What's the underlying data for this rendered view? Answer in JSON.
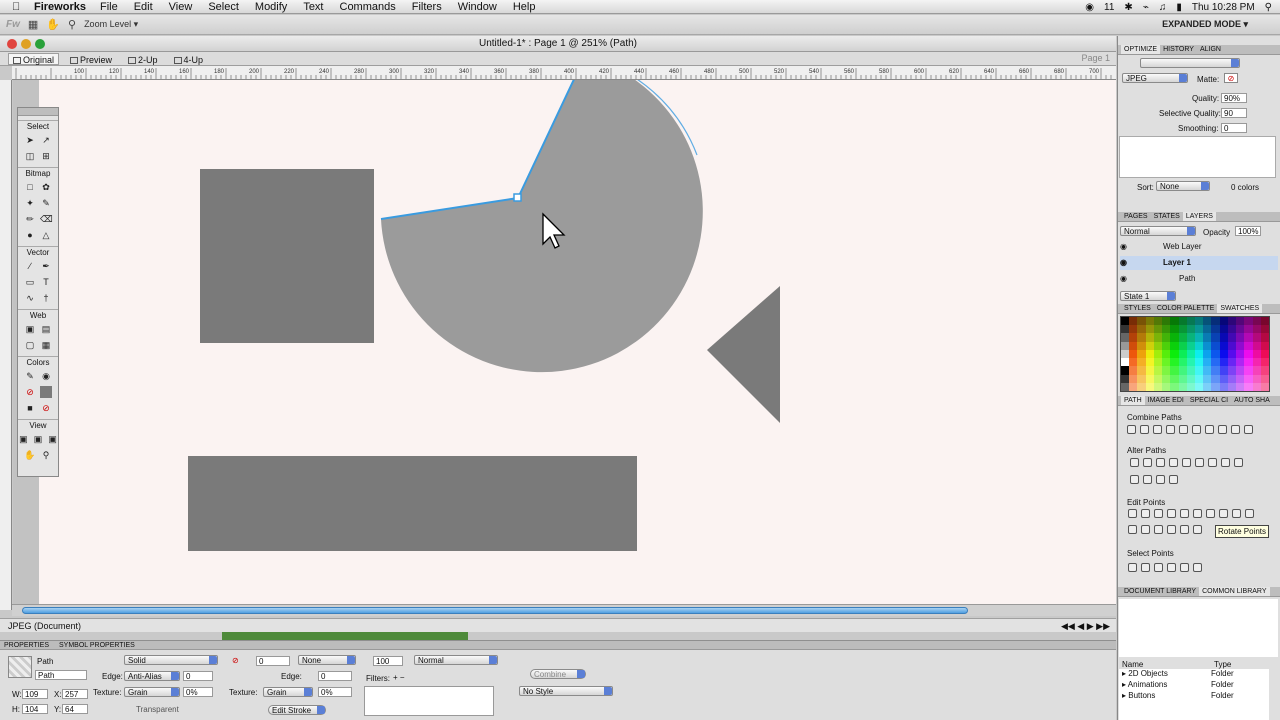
{
  "menubar": {
    "app_name": "Fireworks",
    "items": [
      "File",
      "Edit",
      "View",
      "Select",
      "Modify",
      "Text",
      "Commands",
      "Filters",
      "Window",
      "Help"
    ],
    "status_num": "11",
    "clock": "Thu 10:28 PM"
  },
  "toolbar": {
    "zoom_label": "Zoom Level",
    "expanded_mode": "EXPANDED MODE"
  },
  "document": {
    "title": "Untitled-1* : Page 1 @ 251% (Path)",
    "view_tabs": [
      "Original",
      "Preview",
      "2-Up",
      "4-Up"
    ],
    "page_label": "Page 1",
    "ruler_ticks": [
      "100",
      "120",
      "140",
      "160",
      "180",
      "200",
      "220",
      "240",
      "280",
      "300",
      "320",
      "340",
      "360",
      "380",
      "400",
      "420",
      "440",
      "460",
      "480",
      "500",
      "520",
      "540",
      "560",
      "580",
      "600",
      "620",
      "640",
      "660",
      "680",
      "700"
    ],
    "status": "JPEG (Document)"
  },
  "tools": {
    "sections": [
      "Select",
      "Bitmap",
      "Vector",
      "Web",
      "Colors",
      "View"
    ]
  },
  "properties": {
    "tabs": [
      "PROPERTIES",
      "SYMBOL PROPERTIES"
    ],
    "object_type": "Path",
    "object_name": "Path",
    "fill_type": "Solid",
    "edge_label": "Edge:",
    "edge_value": "Anti-Alias",
    "edge_num": "0",
    "texture_label": "Texture:",
    "texture_value": "Grain",
    "texture_pct": "0%",
    "transparent_label": "Transparent",
    "stroke_size": "0",
    "stroke_type": "None",
    "stroke_edge_label": "Edge:",
    "stroke_edge_num": "0",
    "stroke_texture_label": "Texture:",
    "stroke_texture_value": "Grain",
    "stroke_texture_pct": "0%",
    "edit_stroke": "Edit Stroke",
    "opacity": "100",
    "blend": "Normal",
    "filters_label": "Filters:",
    "combine": "Combine",
    "style": "No Style",
    "w_label": "W:",
    "w": "109",
    "x_label": "X:",
    "x": "257",
    "h_label": "H:",
    "h": "104",
    "y_label": "Y:",
    "y": "64"
  },
  "optimize": {
    "tabs": [
      "OPTIMIZE",
      "HISTORY",
      "ALIGN"
    ],
    "format": "JPEG",
    "matte_label": "Matte:",
    "quality_label": "Quality:",
    "quality": "90%",
    "selective_label": "Selective Quality:",
    "selective": "90",
    "smoothing_label": "Smoothing:",
    "smoothing": "0",
    "sort_label": "Sort:",
    "sort": "None",
    "colors": "0 colors"
  },
  "layers": {
    "tabs": [
      "PAGES",
      "STATES",
      "LAYERS"
    ],
    "blend": "Normal",
    "opacity_label": "Opacity",
    "opacity": "100%",
    "rows": [
      "Web Layer",
      "Layer 1",
      "Path"
    ],
    "state": "State 1"
  },
  "swatches": {
    "tabs": [
      "STYLES",
      "COLOR PALETTE",
      "SWATCHES"
    ]
  },
  "path_panel": {
    "tabs": [
      "PATH",
      "IMAGE EDI",
      "SPECIAL CI",
      "AUTO SHA"
    ],
    "combine_paths": "Combine Paths",
    "alter_paths": "Alter Paths",
    "edit_points": "Edit Points",
    "select_points": "Select Points",
    "tooltip": "Rotate Points"
  },
  "library": {
    "tabs": [
      "DOCUMENT LIBRARY",
      "COMMON LIBRARY"
    ],
    "col_name": "Name",
    "col_type": "Type",
    "rows": [
      {
        "name": "2D Objects",
        "type": "Folder"
      },
      {
        "name": "Animations",
        "type": "Folder"
      },
      {
        "name": "Buttons",
        "type": "Folder"
      }
    ]
  },
  "colors": {
    "shape_gray": "#7a7a7a",
    "circle_gray": "#9b9b9b",
    "selection_blue": "#3a9be0",
    "canvas": "#fbf3f2"
  }
}
